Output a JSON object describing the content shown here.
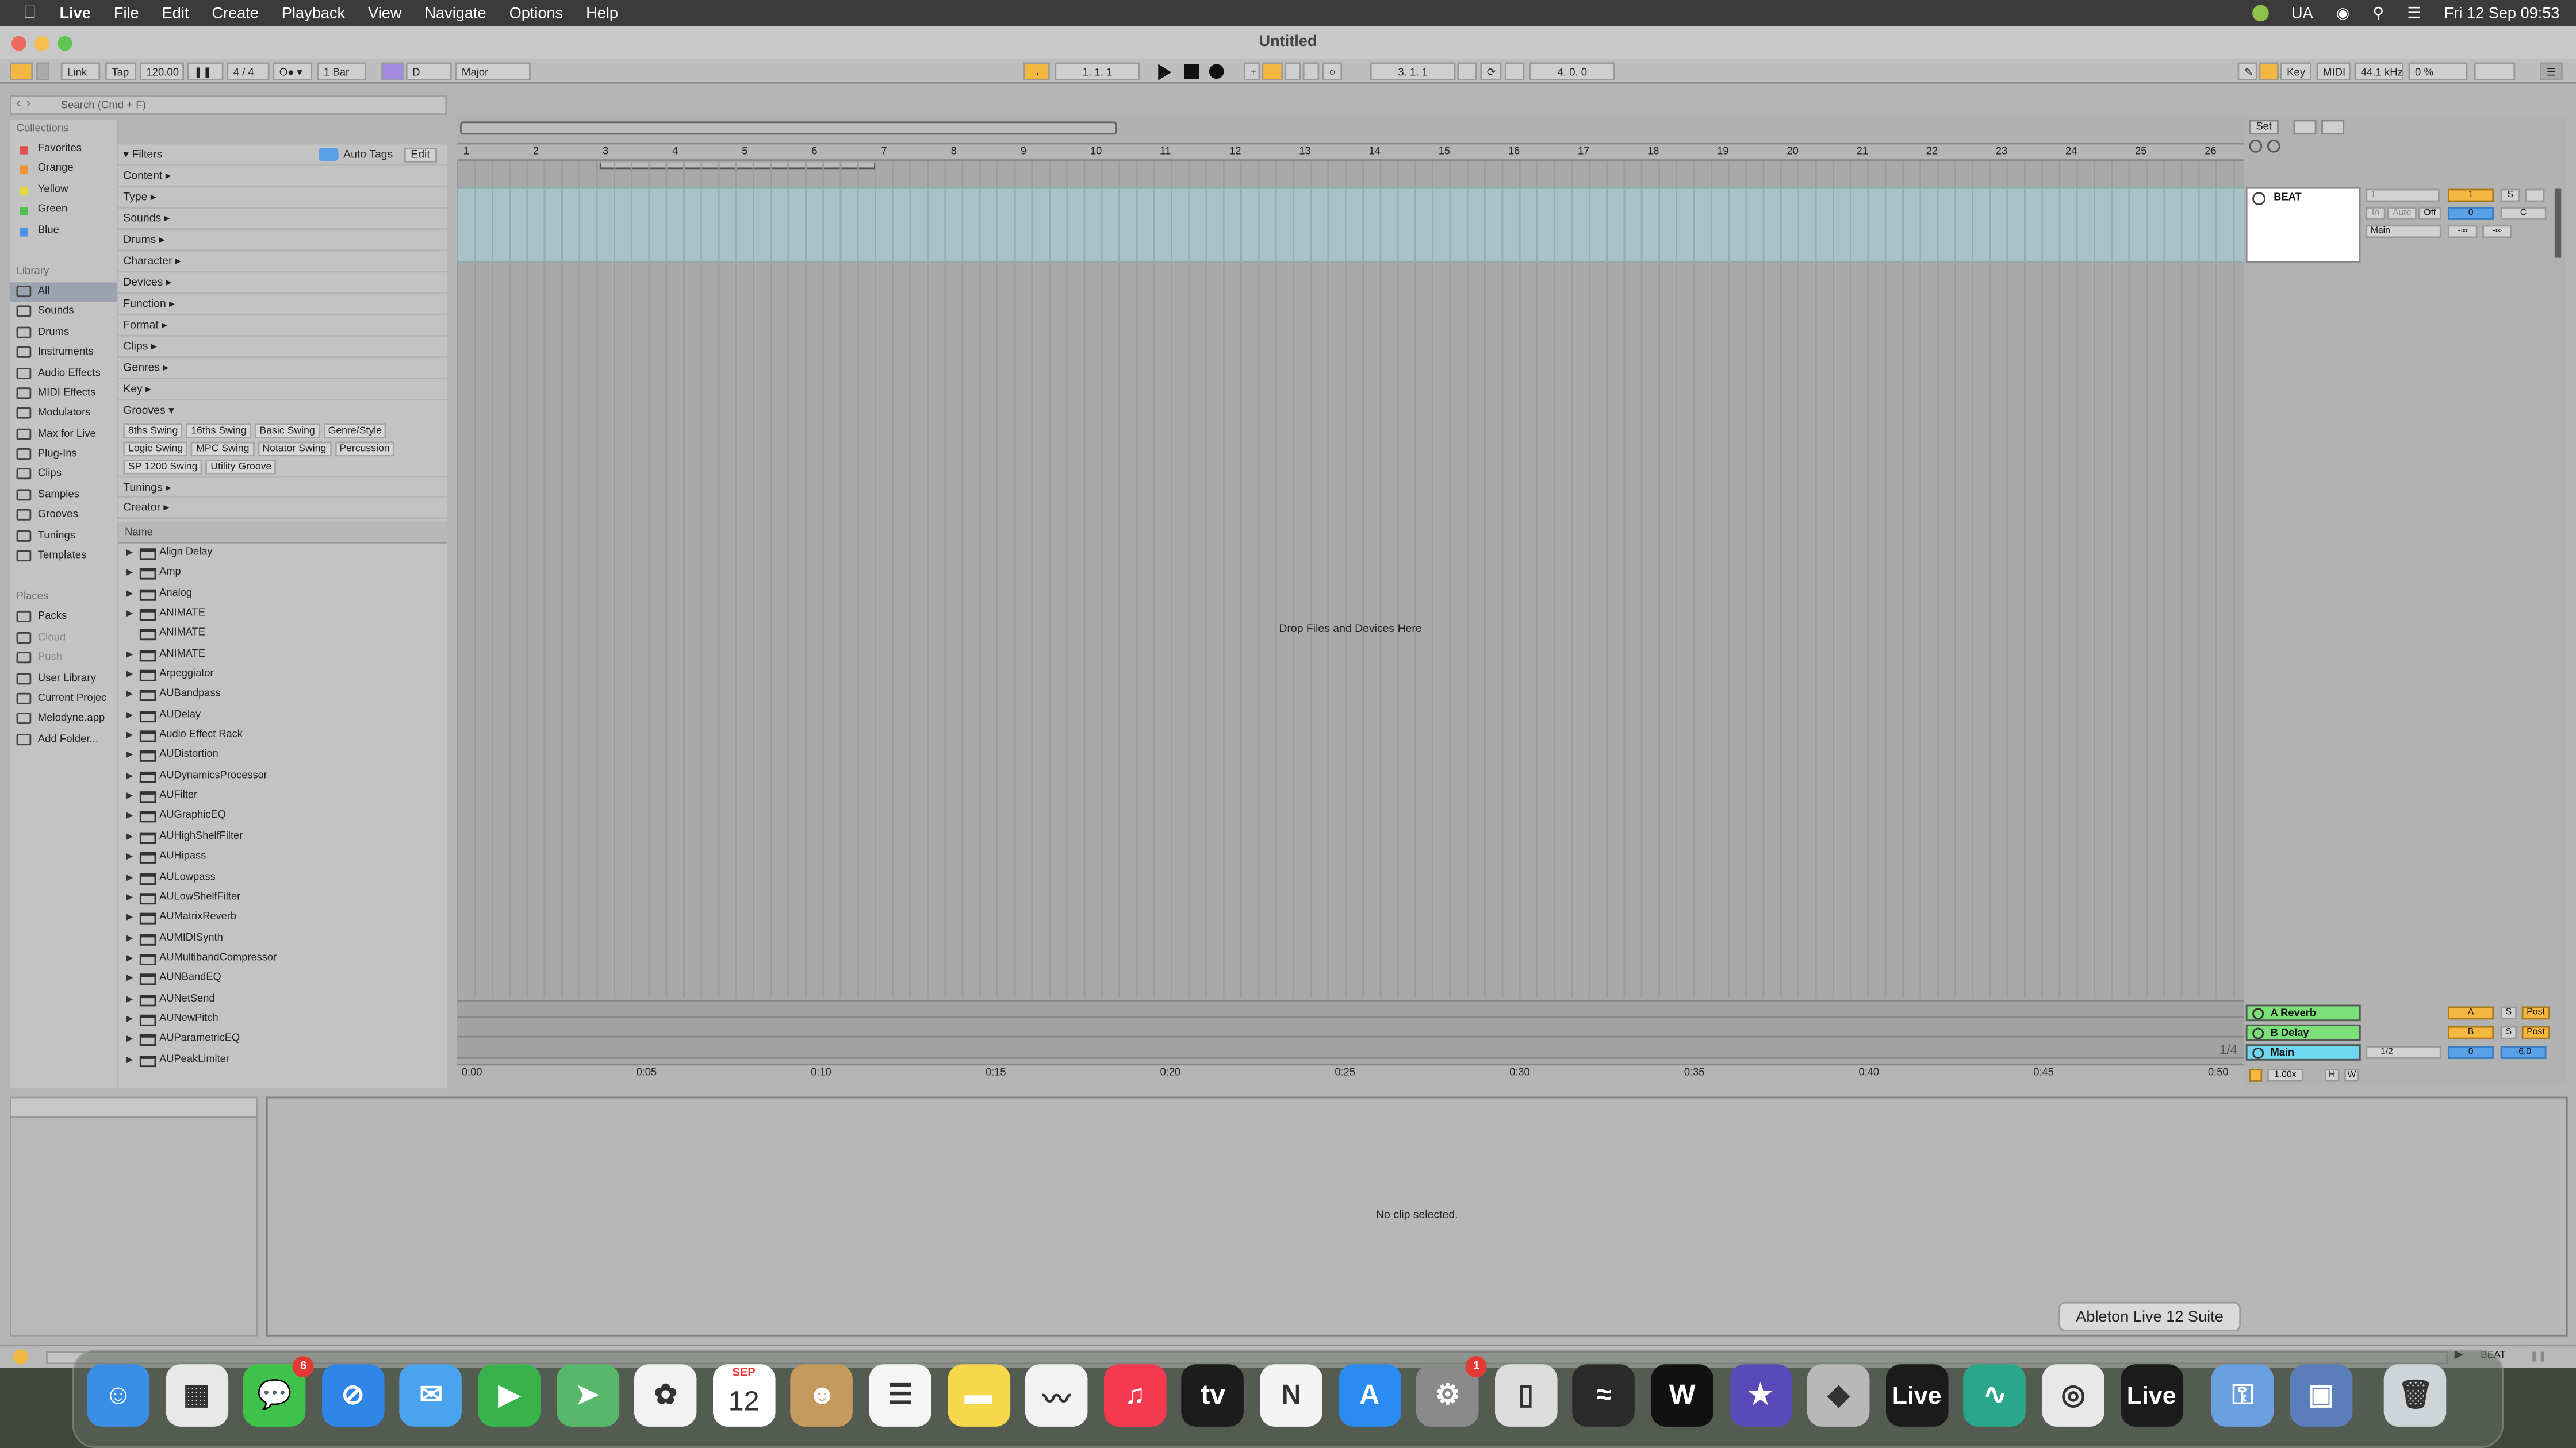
{
  "menubar": {
    "app": "Live",
    "items": [
      "File",
      "Edit",
      "Create",
      "Playback",
      "View",
      "Navigate",
      "Options",
      "Help"
    ],
    "input_source": "UA",
    "datetime": "Fri 12 Sep  09:53"
  },
  "window": {
    "title": "Untitled"
  },
  "control_bar": {
    "link": "Link",
    "tap": "Tap",
    "tempo": "120.00",
    "signature": "4 / 4",
    "quantize": "1 Bar",
    "key": "D",
    "scale": "Major",
    "position": "1.   1.   1",
    "loop_start": "3.   1.   1",
    "loop_length": "4.   0.   0",
    "key_map": "Key",
    "midi_map": "MIDI",
    "sample_rate": "44.1 kHz",
    "cpu": "0 %"
  },
  "browser": {
    "search_placeholder": "Search (Cmd + F)",
    "collections_header": "Collections",
    "collections": [
      {
        "label": "Favorites",
        "color": "#e05050"
      },
      {
        "label": "Orange",
        "color": "#f0922f"
      },
      {
        "label": "Yellow",
        "color": "#e6d83a"
      },
      {
        "label": "Green",
        "color": "#4fbf4f"
      },
      {
        "label": "Blue",
        "color": "#4a8ee8"
      }
    ],
    "library_header": "Library",
    "library": [
      "All",
      "Sounds",
      "Drums",
      "Instruments",
      "Audio Effects",
      "MIDI Effects",
      "Modulators",
      "Max for Live",
      "Plug-Ins",
      "Clips",
      "Samples",
      "Grooves",
      "Tunings",
      "Templates"
    ],
    "places_header": "Places",
    "places": [
      "Packs",
      "Cloud",
      "Push",
      "User Library",
      "Current Projec",
      "Melodyne.app",
      "Add Folder..."
    ],
    "filters_label": "Filters",
    "auto_tags": "Auto Tags",
    "edit": "Edit",
    "filter_rows_top": [
      "Content ▸",
      "Type ▸",
      "Sounds ▸",
      "Drums ▸",
      "Character ▸",
      "Devices ▸",
      "Function ▸",
      "Format ▸",
      "Clips ▸",
      "Genres ▸",
      "Key ▸"
    ],
    "grooves_label": "Grooves ▾",
    "groove_chips": [
      "8ths Swing",
      "16ths Swing",
      "Basic Swing",
      "Genre/Style",
      "Logic Swing",
      "MPC Swing",
      "Notator Swing",
      "Percussion",
      "SP 1200 Swing",
      "Utility Groove"
    ],
    "filter_rows_bottom": [
      "Tunings ▸",
      "Creator ▸"
    ],
    "list_header": "Name",
    "items": [
      "Align Delay",
      "Amp",
      "Analog",
      "ANIMATE",
      "ANIMATE",
      "ANIMATE",
      "Arpeggiator",
      "AUBandpass",
      "AUDelay",
      "Audio Effect Rack",
      "AUDistortion",
      "AUDynamicsProcessor",
      "AUFilter",
      "AUGraphicEQ",
      "AUHighShelfFilter",
      "AUHipass",
      "AULowpass",
      "AULowShelfFilter",
      "AUMatrixReverb",
      "AUMIDISynth",
      "AUMultibandCompressor",
      "AUNBandEQ",
      "AUNetSend",
      "AUNewPitch",
      "AUParametricEQ",
      "AUPeakLimiter"
    ]
  },
  "arrangement": {
    "bars": [
      "1",
      "2",
      "3",
      "4",
      "5",
      "6",
      "7",
      "8",
      "9",
      "10",
      "11",
      "12",
      "13",
      "14",
      "15",
      "16",
      "17",
      "18",
      "19",
      "20",
      "21",
      "22",
      "23",
      "24",
      "25",
      "26"
    ],
    "drop_hint": "Drop Files and Devices Here",
    "times": [
      "0:00",
      "0:05",
      "0:10",
      "0:15",
      "0:20",
      "0:25",
      "0:30",
      "0:35",
      "0:40",
      "0:45",
      "0:50"
    ],
    "grid_label": "1/4",
    "set_label": "Set"
  },
  "mixer": {
    "track_name": "BEAT",
    "track_number": "1",
    "solo": "S",
    "volume_value": "0",
    "pan_value": "C",
    "monitor": [
      "In",
      "Auto",
      "Off"
    ],
    "output": "Main",
    "meter_a": "-∞",
    "meter_b": "-∞",
    "returns": [
      {
        "name": "A Reverb",
        "letter": "A",
        "solo": "S",
        "post": "Post"
      },
      {
        "name": "B Delay",
        "letter": "B",
        "solo": "S",
        "post": "Post"
      }
    ],
    "main": {
      "name": "Main",
      "cue": "1/2",
      "volume": "0",
      "level": "-6.0"
    },
    "zoom": "1.00x",
    "h": "H",
    "w": "W"
  },
  "clip_view": {
    "message": "No clip selected."
  },
  "status_bar": {
    "track": "BEAT"
  },
  "dock": {
    "tooltip": "Ableton Live 12 Suite",
    "apps": [
      {
        "name": "Finder",
        "color": "#3a8ee6",
        "glyph": "☺"
      },
      {
        "name": "Launchpad",
        "color": "#e8e8e8",
        "glyph": "▦"
      },
      {
        "name": "Messages",
        "color": "#3fc24b",
        "glyph": "💬",
        "badge": "6"
      },
      {
        "name": "Safari",
        "color": "#2f86e6",
        "glyph": "⊘"
      },
      {
        "name": "Mail",
        "color": "#4aa3ec",
        "glyph": "✉"
      },
      {
        "name": "FaceTime",
        "color": "#38b24a",
        "glyph": "▶"
      },
      {
        "name": "Maps",
        "color": "#58b86a",
        "glyph": "➤"
      },
      {
        "name": "Photos",
        "color": "#f2f2f2",
        "glyph": "✿"
      },
      {
        "name": "Calendar",
        "color": "#ffffff",
        "glyph": "12",
        "month": "SEP"
      },
      {
        "name": "Contacts",
        "color": "#c59a5c",
        "glyph": "☻"
      },
      {
        "name": "Reminders",
        "color": "#f5f5f5",
        "glyph": "☰"
      },
      {
        "name": "Notes",
        "color": "#f7d84a",
        "glyph": "▬"
      },
      {
        "name": "Freeform",
        "color": "#f2f2f2",
        "glyph": "〰"
      },
      {
        "name": "Music",
        "color": "#f53a4f",
        "glyph": "♫"
      },
      {
        "name": "TV",
        "color": "#1c1c1c",
        "glyph": "tv"
      },
      {
        "name": "News",
        "color": "#f4f4f4",
        "glyph": "N"
      },
      {
        "name": "App Store",
        "color": "#2a8cf0",
        "glyph": "A"
      },
      {
        "name": "System Settings",
        "color": "#8a8a8a",
        "glyph": "⚙",
        "badge": "1"
      },
      {
        "name": "iPhone Mirroring",
        "color": "#dddddd",
        "glyph": "▯"
      },
      {
        "name": "Instrument",
        "color": "#2b2b2b",
        "glyph": "≈"
      },
      {
        "name": "Waves",
        "color": "#111111",
        "glyph": "W"
      },
      {
        "name": "iMovie",
        "color": "#5a4ab8",
        "glyph": "★"
      },
      {
        "name": "Roblox",
        "color": "#b8b8b8",
        "glyph": "◆"
      },
      {
        "name": "Live",
        "color": "#1b1b1b",
        "glyph": "Live"
      },
      {
        "name": "Audio Editor",
        "color": "#2aa68a",
        "glyph": "∿"
      },
      {
        "name": "Chrome",
        "color": "#e8e8e8",
        "glyph": "◎"
      },
      {
        "name": "Live",
        "color": "#1b1b1b",
        "glyph": "Live"
      },
      {
        "name": "Keychain",
        "color": "#6aa0e0",
        "glyph": "⚿"
      },
      {
        "name": "Preview",
        "color": "#5a7fb8",
        "glyph": "▣"
      },
      {
        "name": "Trash",
        "color": "#cfd4d8",
        "glyph": "🗑"
      }
    ]
  }
}
